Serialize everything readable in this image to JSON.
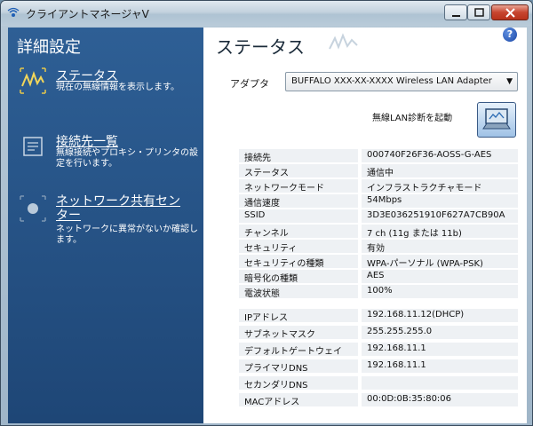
{
  "window": {
    "title": "クライアントマネージャV"
  },
  "sidebar": {
    "title": "詳細設定",
    "items": [
      {
        "label": "ステータス",
        "desc": "現在の無線情報を表示します。"
      },
      {
        "label": "接続先一覧",
        "desc": "無線接続やプロキシ・プリンタの設定を行います。"
      },
      {
        "label": "ネットワーク共有センター",
        "desc": "ネットワークに異常がないか確認します。"
      }
    ]
  },
  "main": {
    "title": "ステータス",
    "help": "?",
    "adapter_label": "アダプタ",
    "adapter_value": "BUFFALO XXX-XX-XXXX   Wireless LAN Adapter",
    "diag_label": "無線LAN診断を起動",
    "rows": [
      {
        "k": "接続先",
        "v": "000740F26F36-AOSS-G-AES"
      },
      {
        "k": "ステータス",
        "v": "通信中"
      },
      {
        "k": "ネットワークモード",
        "v": "インフラストラクチャモード"
      },
      {
        "k": "通信速度",
        "v": "54Mbps"
      },
      {
        "k": "SSID",
        "v": "3D3E036251910F627A7CB90A"
      },
      {
        "k": "チャンネル",
        "v": "7 ch (11g または 11b)"
      },
      {
        "k": "セキュリティ",
        "v": "有効"
      },
      {
        "k": "セキュリティの種類",
        "v": "WPA-パーソナル (WPA-PSK)"
      },
      {
        "k": "暗号化の種類",
        "v": "AES"
      },
      {
        "k": "電波状態",
        "v": "100%"
      },
      {
        "k": "IPアドレス",
        "v": "192.168.11.12(DHCP)"
      },
      {
        "k": "サブネットマスク",
        "v": "255.255.255.0"
      },
      {
        "k": "デフォルトゲートウェイ",
        "v": "192.168.11.1"
      },
      {
        "k": "プライマリDNS",
        "v": "192.168.11.1"
      },
      {
        "k": "セカンダリDNS",
        "v": ""
      },
      {
        "k": "MACアドレス",
        "v": "00:0D:0B:35:80:06"
      }
    ]
  }
}
